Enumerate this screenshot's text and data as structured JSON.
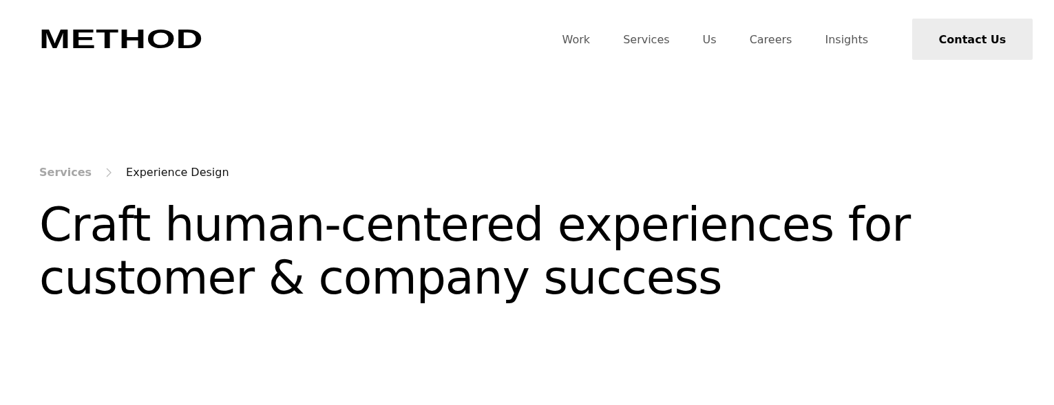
{
  "header": {
    "logo": "METHOD",
    "nav": [
      "Work",
      "Services",
      "Us",
      "Careers",
      "Insights"
    ],
    "cta": "Contact Us"
  },
  "breadcrumb": [
    {
      "label": "Services",
      "current": false
    },
    {
      "label": "Experience Design",
      "current": true
    }
  ],
  "headline": "Craft human-centered experiences for customer & company success"
}
